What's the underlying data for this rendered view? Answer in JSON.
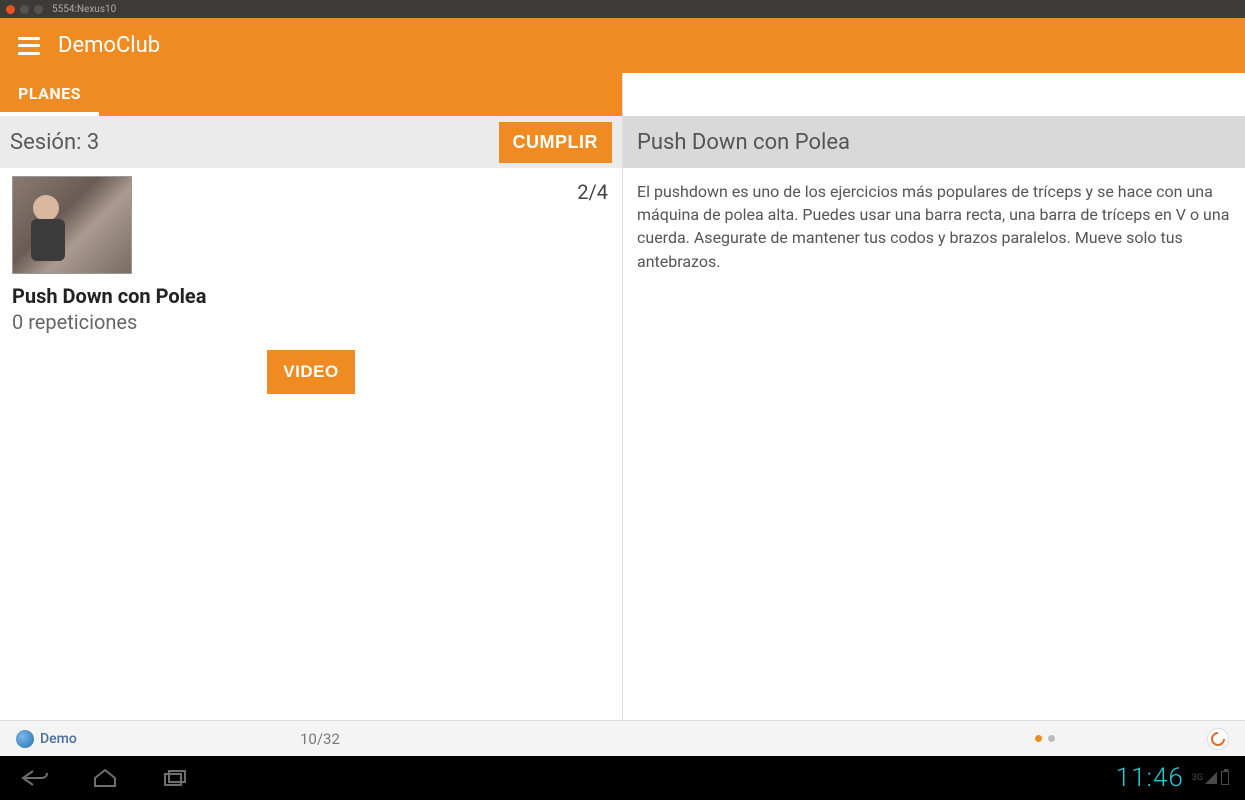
{
  "window": {
    "title": "5554:Nexus10"
  },
  "header": {
    "title": "DemoClub"
  },
  "tabs": {
    "planes": "PLANES"
  },
  "session": {
    "label": "Sesión: 3",
    "action": "CUMPLIR"
  },
  "exercise": {
    "counter": "2/4",
    "title": "Push Down con Polea",
    "reps": "0 repeticiones",
    "video_label": "VIDEO"
  },
  "detail": {
    "title": "Push Down con Polea",
    "body": "El pushdown es uno de los ejercicios más populares de tríceps y se hace con una máquina de polea alta. Puedes usar una barra recta, una barra de tríceps en V o una cuerda. Asegurate de mantener tus codos y brazos paralelos. Mueve solo tus antebrazos."
  },
  "carousel": {
    "demo_label": "Demo",
    "page": "10/32"
  },
  "statusbar": {
    "time": "11:46",
    "net": "3G"
  }
}
